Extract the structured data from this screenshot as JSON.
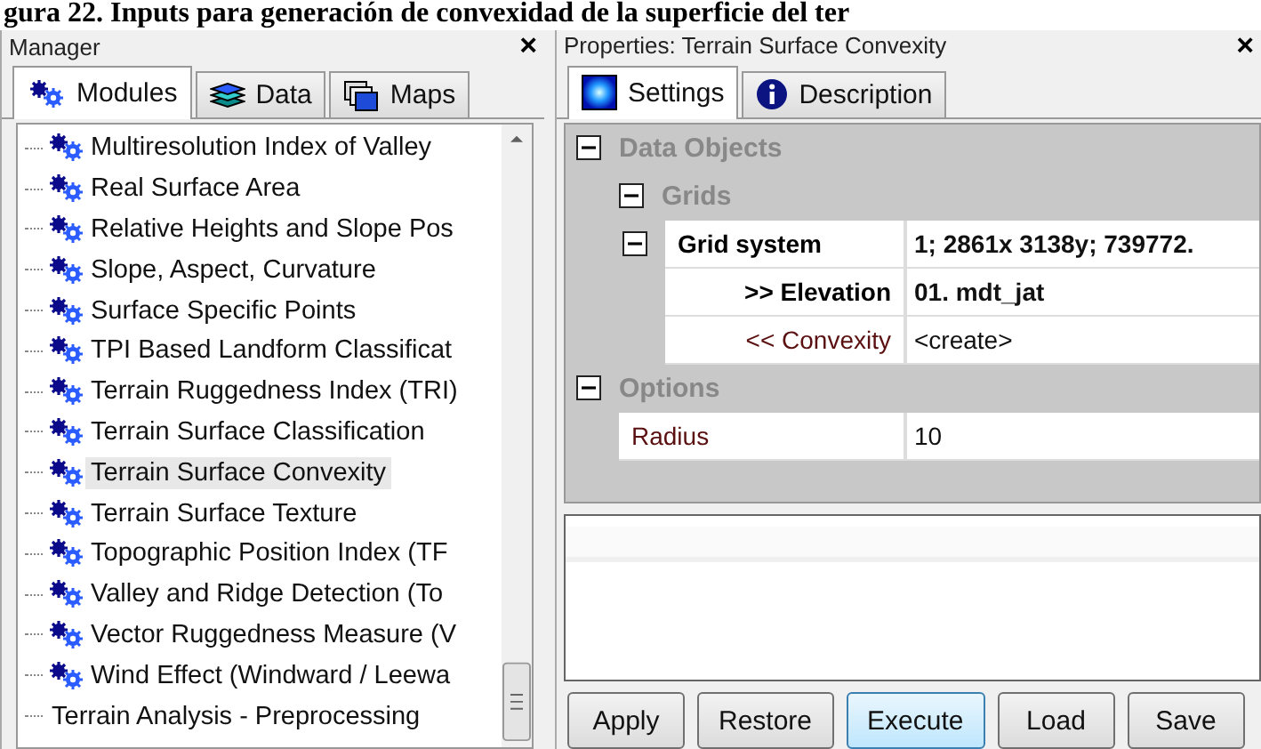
{
  "caption": "gura 22. Inputs para generación de convexidad de la superficie del ter",
  "manager": {
    "title": "Manager",
    "close": "×",
    "tabs": [
      {
        "label": "Modules",
        "selected": true,
        "kind": "modules"
      },
      {
        "label": "Data",
        "selected": false,
        "kind": "data"
      },
      {
        "label": "Maps",
        "selected": false,
        "kind": "maps"
      }
    ],
    "items": [
      {
        "label": "Multiresolution Index of Valley",
        "kind": "tool",
        "selected": false
      },
      {
        "label": "Real Surface Area",
        "kind": "tool",
        "selected": false
      },
      {
        "label": "Relative Heights and Slope Pos",
        "kind": "tool",
        "selected": false
      },
      {
        "label": "Slope, Aspect, Curvature",
        "kind": "tool",
        "selected": false
      },
      {
        "label": "Surface Specific Points",
        "kind": "tool",
        "selected": false
      },
      {
        "label": "TPI Based Landform Classificat",
        "kind": "tool",
        "selected": false
      },
      {
        "label": "Terrain Ruggedness Index (TRI)",
        "kind": "tool",
        "selected": false
      },
      {
        "label": "Terrain Surface Classification",
        "kind": "tool",
        "selected": false
      },
      {
        "label": "Terrain Surface Convexity",
        "kind": "tool",
        "selected": true
      },
      {
        "label": "Terrain Surface Texture",
        "kind": "tool",
        "selected": false
      },
      {
        "label": "Topographic Position Index (TF",
        "kind": "tool",
        "selected": false
      },
      {
        "label": "Valley and Ridge Detection (To",
        "kind": "tool",
        "selected": false
      },
      {
        "label": "Vector Ruggedness Measure (V",
        "kind": "tool",
        "selected": false
      },
      {
        "label": "Wind Effect (Windward / Leewa",
        "kind": "tool",
        "selected": false
      },
      {
        "label": "Terrain Analysis - Preprocessing",
        "kind": "group",
        "selected": false
      }
    ]
  },
  "properties": {
    "title": "Properties: Terrain Surface Convexity",
    "close": "×",
    "tabs": [
      {
        "label": "Settings",
        "selected": true,
        "kind": "settings"
      },
      {
        "label": "Description",
        "selected": false,
        "kind": "info"
      }
    ],
    "rows": [
      {
        "name": "Data Objects",
        "kind": "category",
        "expanded": true,
        "children": [
          {
            "name": "Grids",
            "kind": "category",
            "expanded": true,
            "children": [
              {
                "name": "Grid system",
                "kind": "property",
                "value": "1; 2861x 3138y; 739772.",
                "bold": true,
                "expanded": true,
                "children": [
                  {
                    "name": ">> Elevation",
                    "kind": "property",
                    "value": "01. mdt_jat",
                    "bold": true
                  },
                  {
                    "name": "<< Convexity",
                    "kind": "property",
                    "value": "<create>",
                    "bold": false
                  }
                ]
              }
            ]
          }
        ]
      },
      {
        "name": "Options",
        "kind": "category",
        "expanded": true,
        "children": [
          {
            "name": "Radius",
            "kind": "property",
            "value": "10",
            "bold": false
          }
        ]
      }
    ],
    "buttons": [
      {
        "label": "Apply",
        "selected": false
      },
      {
        "label": "Restore",
        "selected": false
      },
      {
        "label": "Execute",
        "selected": true
      },
      {
        "label": "Load",
        "selected": false
      },
      {
        "label": "Save",
        "selected": false
      }
    ]
  }
}
